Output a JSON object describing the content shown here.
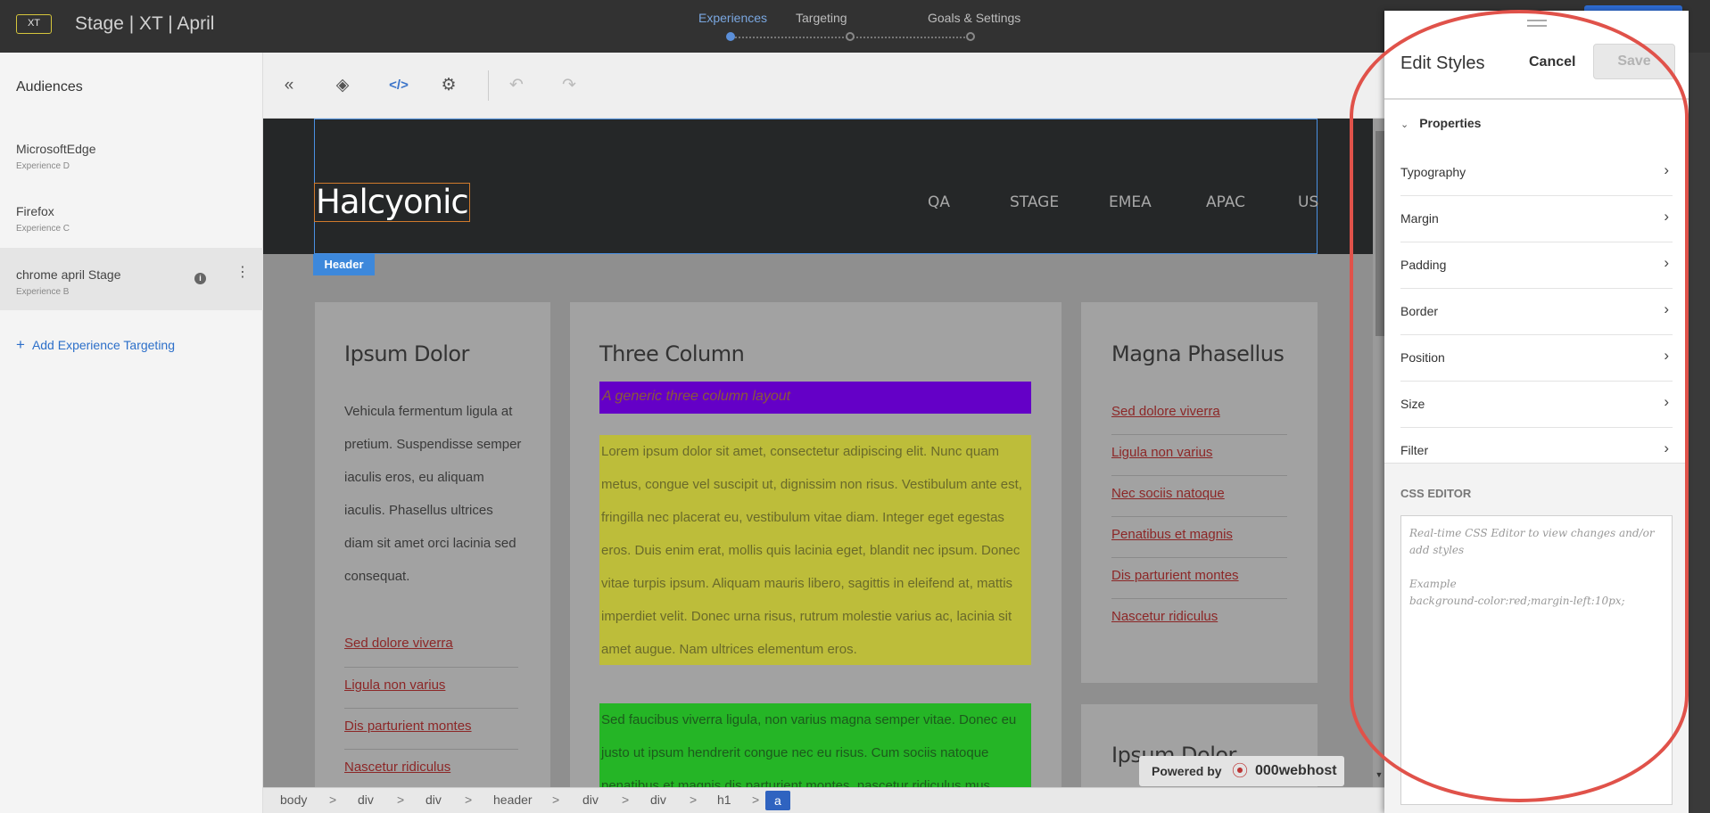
{
  "topbar": {
    "badge": "XT",
    "title": "Stage | XT | April",
    "steps": [
      "Experiences",
      "Targeting",
      "Goals & Settings"
    ]
  },
  "sidebar": {
    "title": "Audiences",
    "items": [
      {
        "name": "MicrosoftEdge",
        "sub": "Experience D"
      },
      {
        "name": "Firefox",
        "sub": "Experience C"
      },
      {
        "name": "chrome april Stage",
        "sub": "Experience B"
      }
    ],
    "info_glyph": "i",
    "more_glyph": "⋮",
    "add_plus": "+",
    "add_label": "Add Experience Targeting"
  },
  "toolbar": {
    "icons": [
      "collapse-icon",
      "layers-icon",
      "code-icon",
      "settings-icon",
      "undo-icon",
      "redo-icon"
    ],
    "collapse_glyph": "«",
    "layers_glyph": "◈",
    "code_glyph": "</>",
    "settings_glyph": "⚙",
    "undo_glyph": "↶",
    "redo_glyph": "↷"
  },
  "site": {
    "logo": "Halcyonic",
    "nav": [
      "QA",
      "STAGE",
      "EMEA",
      "APAC",
      "US"
    ],
    "header_tag": "Header",
    "col1": {
      "title": "Ipsum Dolor",
      "text": "Vehicula fermentum ligula at pretium. Suspendisse semper iaculis eros, eu aliquam iaculis. Phasellus ultrices diam sit amet orci lacinia sed consequat.",
      "links": [
        "Sed dolore viverra",
        "Ligula non varius",
        "Dis parturient montes",
        "Nascetur ridiculus"
      ]
    },
    "col2": {
      "title": "Three Column",
      "tagline": "A generic three column layout",
      "yellow_text": "Lorem ipsum dolor sit amet, consectetur adipiscing elit. Nunc quam metus, congue vel suscipit ut, dignissim non risus. Vestibulum ante est, fringilla nec placerat eu, vestibulum vitae diam. Integer eget egestas eros. Duis enim erat, mollis quis lacinia eget, blandit nec ipsum. Donec vitae turpis ipsum. Aliquam mauris libero, sagittis in eleifend at, mattis imperdiet velit. Donec urna risus, rutrum molestie varius ac, lacinia sit amet augue. Nam ultrices elementum eros.",
      "green_text": "Sed faucibus viverra ligula, non varius magna semper vitae. Donec eu justo ut ipsum hendrerit congue nec eu risus. Cum sociis natoque penatibus et magnis dis parturient montes, nascetur ridiculus mus."
    },
    "col3": {
      "title": "Magna Phasellus",
      "links": [
        "Sed dolore viverra",
        "Ligula non varius",
        "Nec sociis natoque",
        "Penatibus et magnis",
        "Dis parturient montes",
        "Nascetur ridiculus"
      ],
      "title2": "Ipsum Dolor"
    },
    "scroll_glyph": "▼",
    "powered_by": "Powered by",
    "powered_glyph": "⦿",
    "powered_brand": "000webhost"
  },
  "breadcrumb": [
    "body",
    "div",
    "div",
    "header",
    "div",
    "div",
    "h1",
    "a"
  ],
  "breadcrumb_sep": ">",
  "panel": {
    "title": "Edit Styles",
    "cancel": "Cancel",
    "save": "Save",
    "properties_chevron": "⌄",
    "properties_label": "Properties",
    "rows": [
      "Typography",
      "Margin",
      "Padding",
      "Border",
      "Position",
      "Size",
      "Filter"
    ],
    "row_arrow": "›",
    "css_label": "CSS EDITOR",
    "css_placeholder": "Real-time CSS Editor to view changes and/or add styles\n\nExample\nbackground-color:red;margin-left:10px;"
  },
  "colors": {
    "accent": "#2d6bd2",
    "highlight": "#e0524a",
    "tagline_bg": "#6400c7",
    "yellow_box": "#bdbd3a",
    "green_box": "#25b526"
  }
}
